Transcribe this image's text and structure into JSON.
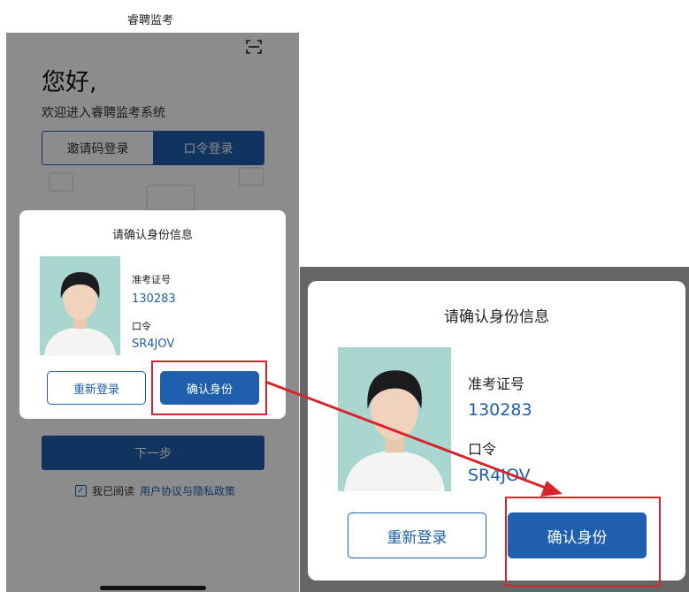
{
  "app": {
    "title": "睿聘监考"
  },
  "login": {
    "greeting": "您好,",
    "welcome": "欢迎进入睿聘监考系统",
    "tabs": [
      {
        "label": "邀请码登录",
        "active": false
      },
      {
        "label": "口令登录",
        "active": true
      }
    ],
    "next_label": "下一步",
    "agreement_prefix": "我已阅读",
    "agreement_link": "用户协议与隐私政策",
    "agreement_checked": true
  },
  "dialog": {
    "title": "请确认身份信息",
    "exam_id_label": "准考证号",
    "exam_id_value": "130283",
    "password_label": "口令",
    "password_value": "SR4JOV",
    "relogin_label": "重新登录",
    "confirm_label": "确认身份"
  },
  "colors": {
    "primary": "#1e5fae",
    "highlight": "#d9232a",
    "overlay": "rgba(0,0,0,0.45)"
  },
  "icons": {
    "scan": "scan-icon",
    "check": "checkbox-check-icon",
    "avatar": "avatar-photo"
  }
}
